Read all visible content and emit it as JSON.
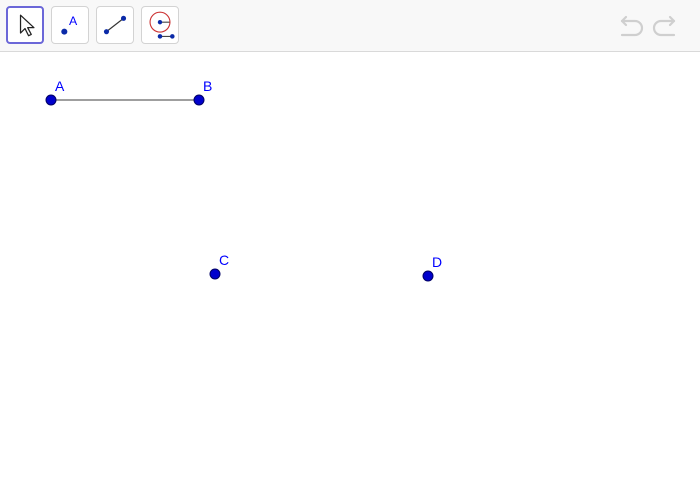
{
  "colors": {
    "point_fill": "#0000cc",
    "point_stroke": "#000066",
    "label": "#0000ff",
    "segment": "#666666",
    "toolbar_bg": "#f8f8f8",
    "selected_border": "#6b67d8",
    "history_icon": "#cfcfcf",
    "circle_tool_red": "#cc3333"
  },
  "toolbar": {
    "tools": [
      {
        "name": "move",
        "icon": "pointer-arrow-icon",
        "selected": true
      },
      {
        "name": "point",
        "icon": "point-tool-icon",
        "label": "A"
      },
      {
        "name": "segment",
        "icon": "segment-tool-icon"
      },
      {
        "name": "circle",
        "icon": "circle-with-radius-tool-icon"
      }
    ],
    "history": [
      {
        "name": "undo",
        "icon": "undo-icon",
        "enabled": false
      },
      {
        "name": "redo",
        "icon": "redo-icon",
        "enabled": false
      }
    ]
  },
  "geometry": {
    "points": [
      {
        "name": "A",
        "label": "A"
      },
      {
        "name": "B",
        "label": "B"
      },
      {
        "name": "C",
        "label": "C"
      },
      {
        "name": "D",
        "label": "D"
      }
    ],
    "segments": [
      {
        "name": "AB",
        "from": "A",
        "to": "B"
      }
    ]
  }
}
